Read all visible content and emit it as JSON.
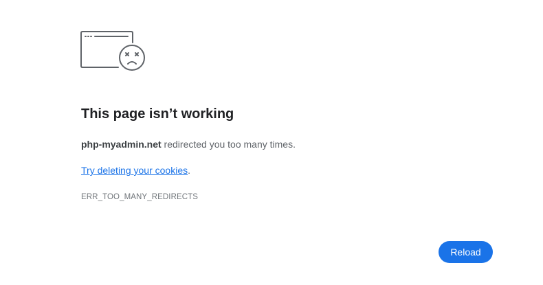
{
  "error_page": {
    "icon": "sad-face-browser-window-icon",
    "title": "This page isn’t working",
    "message": {
      "domain": "php-myadmin.net",
      "text": " redirected you too many times."
    },
    "suggestion": {
      "link_text": "Try deleting your cookies",
      "suffix": "."
    },
    "error_code": "ERR_TOO_MANY_REDIRECTS",
    "reload_label": "Reload"
  },
  "colors": {
    "accent": "#1a73e8",
    "title": "#202124",
    "body_text": "#5f6368",
    "icon_stroke": "#5f6368"
  }
}
